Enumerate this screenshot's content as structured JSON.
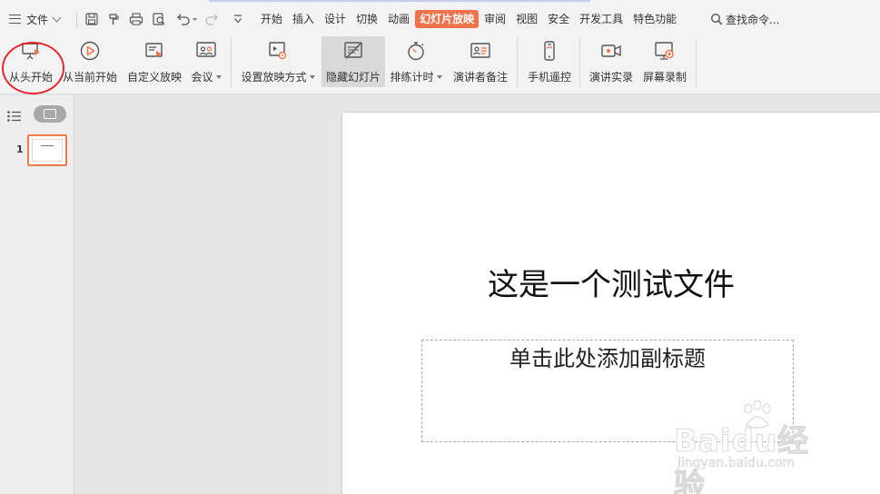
{
  "menubar": {
    "file_label": "文件",
    "tabs": [
      {
        "label": "开始",
        "active": false
      },
      {
        "label": "插入",
        "active": false
      },
      {
        "label": "设计",
        "active": false
      },
      {
        "label": "切换",
        "active": false
      },
      {
        "label": "动画",
        "active": false
      },
      {
        "label": "幻灯片放映",
        "active": true
      },
      {
        "label": "审阅",
        "active": false
      },
      {
        "label": "视图",
        "active": false
      },
      {
        "label": "安全",
        "active": false
      },
      {
        "label": "开发工具",
        "active": false
      },
      {
        "label": "特色功能",
        "active": false
      }
    ],
    "search_label": "查找命令..."
  },
  "ribbon": {
    "from_start": "从头开始",
    "from_current": "从当前开始",
    "custom_show": "自定义放映",
    "meeting": "会议",
    "setup_show": "设置放映方式",
    "hide_slide": "隐藏幻灯片",
    "rehearse_timing": "排练计时",
    "presenter_notes": "演讲者备注",
    "phone_remote": "手机遥控",
    "record_presentation": "演讲实录",
    "screen_recording": "屏幕录制"
  },
  "slides_panel": {
    "slide_number": "1"
  },
  "slide": {
    "title": "这是一个测试文件",
    "subtitle_placeholder": "单击此处添加副标题"
  },
  "watermark": {
    "brand": "Baidu经验",
    "url": "jingyan.baidu.com"
  },
  "colors": {
    "accent": "#f0734b",
    "highlight_circle": "#e5262b",
    "thumbnail_border": "#ee7c46"
  }
}
